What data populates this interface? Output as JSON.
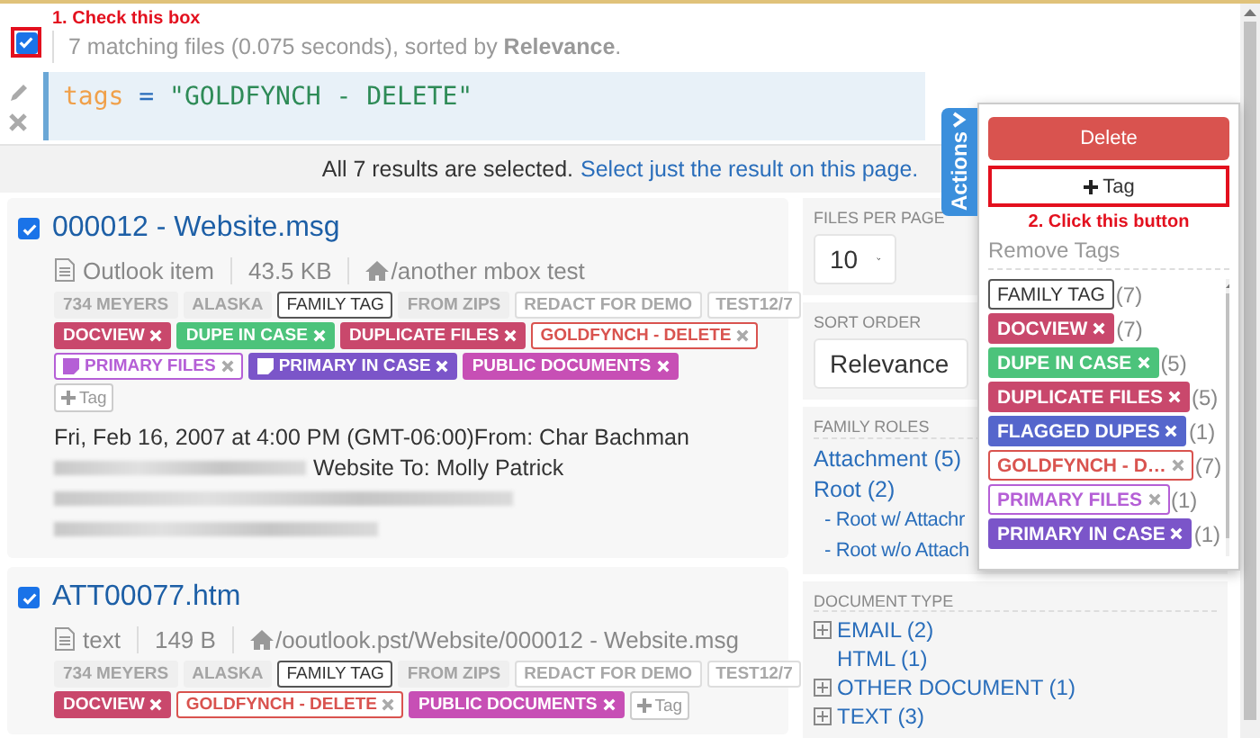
{
  "annotations": {
    "checkbox_hint": "1. Check this box",
    "button_hint": "2. Click this button"
  },
  "header": {
    "select_all_checked": true,
    "summary": "7 matching files (0.075 seconds), sorted by **Relevance**."
  },
  "query": {
    "field": "tags",
    "operator": "=",
    "value": "\"GOLDFYNCH - DELETE\""
  },
  "selection_banner": {
    "text": "All 7 results are selected.",
    "link": "Select just the result on this page."
  },
  "results": [
    {
      "checked": true,
      "title": "000012 - Website.msg",
      "type": "Outlook item",
      "size": "43.5 KB",
      "path": "/another mbox test",
      "tag_rows": [
        [
          {
            "kind": "inherited",
            "label": "734 MEYERS"
          },
          {
            "kind": "inherited",
            "label": "ALASKA"
          },
          {
            "kind": "plain",
            "label": "FAMILY TAG"
          },
          {
            "kind": "inherited",
            "label": "FROM ZIPS"
          },
          {
            "kind": "faint",
            "label": "REDACT FOR DEMO"
          },
          {
            "kind": "faint",
            "label": "TEST12/7"
          }
        ],
        [
          {
            "kind": "solid",
            "label": "DOCVIEW",
            "color": "#c9486c"
          },
          {
            "kind": "solid",
            "label": "DUPE IN CASE",
            "color": "#4cc37b"
          },
          {
            "kind": "solid",
            "label": "DUPLICATE FILES",
            "color": "#c9486c"
          },
          {
            "kind": "outline",
            "label": "GOLDFYNCH - DELETE",
            "color": "#d9534f"
          }
        ],
        [
          {
            "kind": "outline",
            "label": "PRIMARY FILES",
            "color": "#b55fd6",
            "icon": true
          },
          {
            "kind": "solid",
            "label": "PRIMARY IN CASE",
            "color": "#7b55c9",
            "icon": true
          },
          {
            "kind": "solid",
            "label": "PUBLIC DOCUMENTS",
            "color": "#c74fb5"
          }
        ],
        [
          {
            "kind": "add",
            "label": "Tag"
          }
        ]
      ],
      "body": [
        {
          "text": "Fri, Feb 16, 2007 at 4:00 PM (GMT-06:00)From: Char Bachman",
          "blurred": false
        },
        {
          "text": "Website To: Molly Patrick",
          "blurred": true
        },
        {
          "blurred": true
        },
        {
          "blurred": true
        }
      ]
    },
    {
      "checked": true,
      "title": "ATT00077.htm",
      "type": "text",
      "size": "149 B",
      "path": "/ooutlook.pst/Website/000012 - Website.msg",
      "tag_rows": [
        [
          {
            "kind": "inherited",
            "label": "734 MEYERS"
          },
          {
            "kind": "inherited",
            "label": "ALASKA"
          },
          {
            "kind": "plain",
            "label": "FAMILY TAG"
          },
          {
            "kind": "inherited",
            "label": "FROM ZIPS"
          },
          {
            "kind": "faint",
            "label": "REDACT FOR DEMO"
          },
          {
            "kind": "faint",
            "label": "TEST12/7"
          }
        ],
        [
          {
            "kind": "solid",
            "label": "DOCVIEW",
            "color": "#c9486c"
          },
          {
            "kind": "outline",
            "label": "GOLDFYNCH - DELETE",
            "color": "#d9534f"
          },
          {
            "kind": "solid",
            "label": "PUBLIC DOCUMENTS",
            "color": "#c74fb5"
          },
          {
            "kind": "add",
            "label": "Tag"
          }
        ]
      ]
    }
  ],
  "sidebar": {
    "files_per_page": {
      "label": "FILES PER PAGE",
      "value": "10"
    },
    "sort_order": {
      "label": "SORT ORDER",
      "value": "Relevance"
    },
    "family_roles": {
      "label": "FAMILY ROLES",
      "items": [
        {
          "label": "Attachment (5)",
          "indent": false
        },
        {
          "label": "Root (2)",
          "indent": false
        },
        {
          "label": "- Root w/ Attachr",
          "indent": true
        },
        {
          "label": "- Root w/o Attach",
          "indent": true
        }
      ]
    },
    "document_type": {
      "label": "DOCUMENT TYPE",
      "items": [
        {
          "label": "EMAIL (2)",
          "expandable": true
        },
        {
          "label": "HTML (1)",
          "expandable": false
        },
        {
          "label": "OTHER DOCUMENT (1)",
          "expandable": true
        },
        {
          "label": "TEXT (3)",
          "expandable": true
        }
      ]
    }
  },
  "actions": {
    "tab": "Actions",
    "delete": "Delete",
    "add_tag": "Tag",
    "remove_tags": "Remove Tags",
    "tags": [
      {
        "kind": "plain",
        "label": "FAMILY TAG",
        "count": "(7)"
      },
      {
        "kind": "solid",
        "label": "DOCVIEW",
        "color": "#c9486c",
        "count": "(7)"
      },
      {
        "kind": "solid",
        "label": "DUPE IN CASE",
        "color": "#4cc37b",
        "count": "(5)"
      },
      {
        "kind": "solid",
        "label": "DUPLICATE FILES",
        "color": "#c9486c",
        "count": "(5)"
      },
      {
        "kind": "solid",
        "label": "FLAGGED DUPES",
        "color": "#5566cc",
        "count": "(1)"
      },
      {
        "kind": "outline",
        "label": "GOLDFYNCH - D…",
        "color": "#d9534f",
        "count": "(7)"
      },
      {
        "kind": "outline",
        "label": "PRIMARY FILES",
        "color": "#b55fd6",
        "count": "(1)"
      },
      {
        "kind": "solid",
        "label": "PRIMARY IN CASE",
        "color": "#7b55c9",
        "count": "(1)"
      }
    ]
  }
}
